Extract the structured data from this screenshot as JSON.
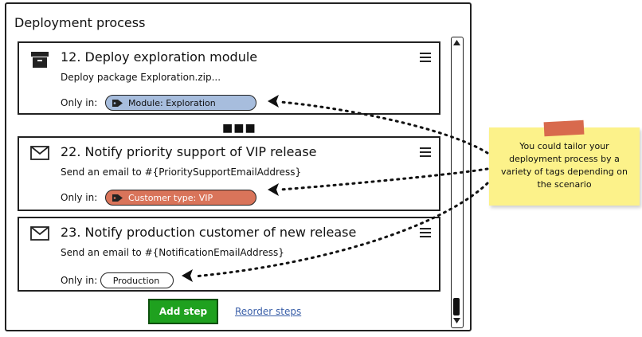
{
  "panel": {
    "title": "Deployment process"
  },
  "steps": [
    {
      "title": "12. Deploy exploration module",
      "description": "Deploy package Exploration.zip...",
      "only_in_label": "Only in:",
      "tag_label": "Module: Exploration",
      "tag_color": "#a7bddd",
      "icon": "package-icon"
    },
    {
      "title": "22. Notify priority support of VIP release",
      "description": "Send an email to #{PrioritySupportEmailAddress}",
      "only_in_label": "Only in:",
      "tag_label": "Customer type: VIP",
      "tag_color": "#d9745a",
      "icon": "envelope-icon"
    },
    {
      "title": "23. Notify production customer of new release",
      "description": "Send an email to #{NotificationEmailAddress}",
      "only_in_label": "Only in:",
      "tag_label": "Production",
      "tag_color": "#ffffff",
      "icon": "envelope-icon"
    }
  ],
  "more_indicator": "■■■",
  "actions": {
    "add_step": "Add step",
    "add_step_color": "#1fa11f",
    "reorder_steps": "Reorder steps"
  },
  "note": {
    "text": "You could tailor your deployment process by a variety of tags depending on the scenario",
    "color": "#fcf28a",
    "tape_color": "#d86a4d"
  }
}
